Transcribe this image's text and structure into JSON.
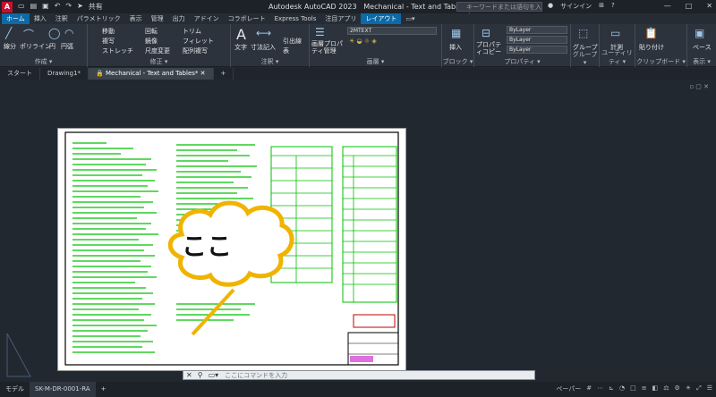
{
  "app": {
    "badge": "A",
    "title": "Autodesk AutoCAD 2023",
    "file_title": "Mechanical - Text and Tables.dwg - 読み込み専用",
    "share_label": "共有"
  },
  "search": {
    "placeholder": "キーワードまたは語句を入力"
  },
  "account": {
    "signin": "サインイン"
  },
  "ribbon_tabs": [
    "ホーム",
    "挿入",
    "注釈",
    "パラメトリック",
    "表示",
    "管理",
    "出力",
    "アドイン",
    "コラボレート",
    "Express Tools",
    "注目アプリ",
    "レイアウト"
  ],
  "panels": {
    "draw": {
      "title": "作成 ▾",
      "line": "線分",
      "polyline": "ポリライン",
      "circle": "円",
      "arc": "円弧"
    },
    "modify": {
      "title": "修正 ▾",
      "move": "移動",
      "rotate": "回転",
      "trim": "トリム",
      "copy": "複写",
      "mirror": "鏡像",
      "fillet": "フィレット",
      "stretch": "ストレッチ",
      "scale": "尺度変更",
      "array": "配列複写"
    },
    "annotation": {
      "title": "注釈 ▾",
      "text": "文字",
      "dimension": "寸法記入",
      "leader": "引出線",
      "table": "表"
    },
    "layers": {
      "title": "画層 ▾",
      "layer_props": "画層プロパティ管理",
      "current_layer": "2MTEXT"
    },
    "block": {
      "title": "ブロック ▾",
      "insert": "挿入"
    },
    "properties": {
      "title": "プロパティ ▾",
      "match": "プロパティコピー",
      "color": "ByLayer",
      "linetype": "ByLayer",
      "lineweight": "ByLayer"
    },
    "groups": {
      "title": "グループ ▾",
      "group": "グループ"
    },
    "utilities": {
      "title": "ユーティリティ ▾",
      "measure": "計測"
    },
    "clipboard": {
      "title": "クリップボード ▾",
      "paste": "貼り付け"
    },
    "view": {
      "title": "表示 ▾",
      "base": "ベース"
    }
  },
  "doc_tabs": [
    "スタート",
    "Drawing1*",
    "Mechanical - Text and Tables*"
  ],
  "sheet": {
    "title": "ここ"
  },
  "command": {
    "placeholder": "ここにコマンドを入力"
  },
  "status": {
    "model": "モデル",
    "layout": "SK-M-DR-0001-RA",
    "paper": "ペーパー"
  },
  "colors": {
    "accent": "#0b6aa7",
    "cad_green": "#00c000",
    "bubble_yellow": "#f0b400"
  }
}
